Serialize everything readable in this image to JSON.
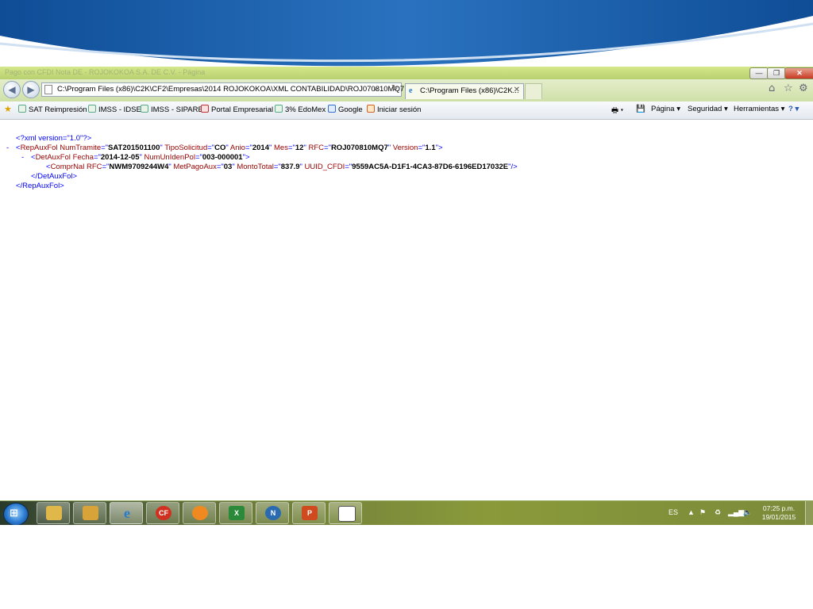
{
  "window": {
    "title": "Pago con CFDI Nota DE - ROJOKOKOA S.A. DE C.V. - Página",
    "controls": {
      "minimize": "—",
      "restore": "❐",
      "close": "✕"
    }
  },
  "navigation": {
    "back_icon": "◀",
    "forward_icon": "▶",
    "address": "C:\\Program Files (x86)\\C2K\\CF2\\Empresas\\2014 ROJOKOKOA\\XML CONTABILIDAD\\ROJ070810MQ7",
    "search_icon": "⌕",
    "refresh_icon": "↻",
    "tab_title": "C:\\Program Files (x86)\\C2K...",
    "tab_close": "✕",
    "home_icon": "⌂",
    "favorites_icon": "☆",
    "tools_icon": "⚙"
  },
  "favorites": {
    "items": [
      {
        "label": "SAT Reimpresión"
      },
      {
        "label": "IMSS - IDSE"
      },
      {
        "label": "IMSS - SIPARE"
      },
      {
        "label": "Portal Empresarial"
      },
      {
        "label": "3% EdoMex"
      },
      {
        "label": "Google"
      },
      {
        "label": "Iniciar sesión"
      }
    ],
    "commands": {
      "page": "Página ▾",
      "security": "Seguridad ▾",
      "tools": "Herramientas ▾",
      "help": "? ▾"
    }
  },
  "xml": {
    "pi": "<?xml version=\"1.0\"?>",
    "root": {
      "name": "RepAuxFol",
      "attrs": [
        {
          "name": "NumTramite",
          "value": "SAT201501100"
        },
        {
          "name": "TipoSolicitud",
          "value": "CO"
        },
        {
          "name": "Anio",
          "value": "2014"
        },
        {
          "name": "Mes",
          "value": "12"
        },
        {
          "name": "RFC",
          "value": "ROJ070810MQ7"
        },
        {
          "name": "Version",
          "value": "1.1"
        }
      ],
      "close": "</RepAuxFol>"
    },
    "detail": {
      "name": "DetAuxFol",
      "attrs": [
        {
          "name": "Fecha",
          "value": "2014-12-05"
        },
        {
          "name": "NumUnIdenPol",
          "value": "003-000001"
        }
      ],
      "close": "</DetAuxFol>"
    },
    "compr": {
      "name": "ComprNal",
      "attrs": [
        {
          "name": "RFC",
          "value": "NWM9709244W4"
        },
        {
          "name": "MetPagoAux",
          "value": "03"
        },
        {
          "name": "MontoTotal",
          "value": "837.9"
        },
        {
          "name": "UUID_CFDI",
          "value": "9559AC5A-D1F1-4CA3-87D6-6196ED17032E"
        }
      ]
    },
    "collapse": "-"
  },
  "taskbar": {
    "apps": [
      {
        "name": "explorer",
        "label": "",
        "color": "#e0b84a"
      },
      {
        "name": "folder",
        "label": "",
        "color": "#d8a43a"
      },
      {
        "name": "internet-explorer",
        "label": "e",
        "color": "#2a7ad0"
      },
      {
        "name": "cf",
        "label": "CF",
        "color": "#d03020"
      },
      {
        "name": "nomipaq",
        "label": "",
        "color": "#f08a20"
      },
      {
        "name": "excel",
        "label": "X",
        "color": "#2a8a3a"
      },
      {
        "name": "n-app",
        "label": "N",
        "color": "#2a6ab0"
      },
      {
        "name": "powerpoint",
        "label": "P",
        "color": "#d04a20"
      },
      {
        "name": "document",
        "label": "",
        "color": "#ffffff"
      }
    ],
    "lang": "ES",
    "time": "07:25 p.m.",
    "date": "19/01/2015"
  },
  "colors": {
    "xml_markup": "#0000ff",
    "xml_name": "#990000",
    "xml_value": "#000000",
    "header_blue": "#1f5fa8"
  }
}
